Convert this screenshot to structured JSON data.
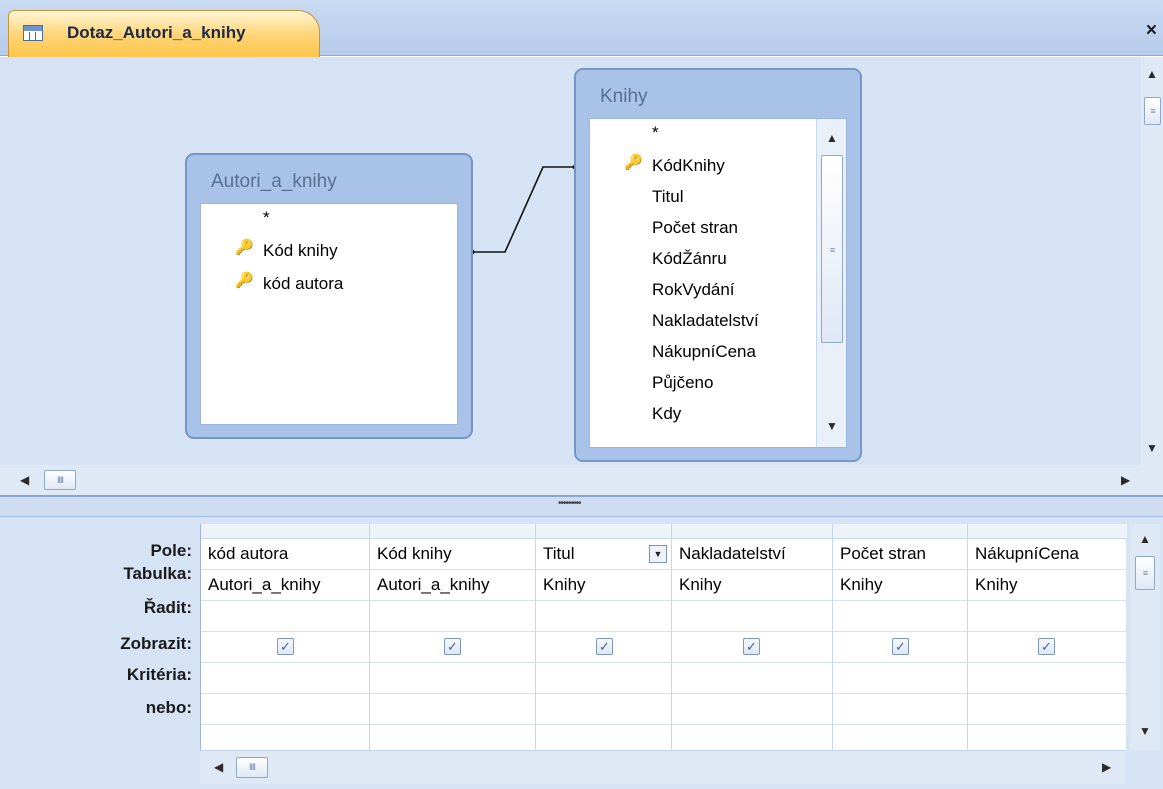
{
  "window": {
    "tab_title": "Dotaz_Autori_a_knihy",
    "close_glyph": "×"
  },
  "icons": {
    "tab": "query-datasheet-icon",
    "key": "primary-key-icon",
    "check": "checkbox-checked-icon"
  },
  "tables": [
    {
      "name": "Autori_a_knihy",
      "fields": [
        {
          "label": "*",
          "key": false
        },
        {
          "label": "Kód knihy",
          "key": true
        },
        {
          "label": "kód autora",
          "key": true
        }
      ]
    },
    {
      "name": "Knihy",
      "fields": [
        {
          "label": "*",
          "key": false
        },
        {
          "label": "KódKnihy",
          "key": true
        },
        {
          "label": "Titul",
          "key": false
        },
        {
          "label": "Počet stran",
          "key": false
        },
        {
          "label": "KódŽánru",
          "key": false
        },
        {
          "label": "RokVydání",
          "key": false
        },
        {
          "label": "Nakladatelství",
          "key": false
        },
        {
          "label": "NákupníCena",
          "key": false
        },
        {
          "label": "Půjčeno",
          "key": false
        },
        {
          "label": "Kdy",
          "key": false
        }
      ]
    }
  ],
  "grid": {
    "row_labels": [
      "Pole:",
      "Tabulka:",
      "Řadit:",
      "Zobrazit:",
      "Kritéria:",
      "nebo:"
    ],
    "columns": [
      {
        "field": "kód autora",
        "table": "Autori_a_knihy",
        "sort": "",
        "show": true,
        "criteria": "",
        "or": ""
      },
      {
        "field": "Kód knihy",
        "table": "Autori_a_knihy",
        "sort": "",
        "show": true,
        "criteria": "",
        "or": ""
      },
      {
        "field": "Titul",
        "table": "Knihy",
        "sort": "",
        "show": true,
        "criteria": "",
        "or": ""
      },
      {
        "field": "Nakladatelství",
        "table": "Knihy",
        "sort": "",
        "show": true,
        "criteria": "",
        "or": ""
      },
      {
        "field": "Počet stran",
        "table": "Knihy",
        "sort": "",
        "show": true,
        "criteria": "",
        "or": ""
      },
      {
        "field": "NákupníCena",
        "table": "Knihy",
        "sort": "",
        "show": true,
        "criteria": "",
        "or": ""
      }
    ]
  },
  "glyphs": {
    "arrow_left": "◀",
    "arrow_right": "▶",
    "arrow_up": "▲",
    "arrow_down": "▼",
    "checkmark": "✓",
    "dropdown": "▼",
    "splitter_grip": "•••••••••"
  },
  "colors": {
    "tab_active": "#ffc64a",
    "designer_bg": "#d6e3f5",
    "table_frame": "#a8c3e7",
    "check_accent": "#3a64a6"
  }
}
